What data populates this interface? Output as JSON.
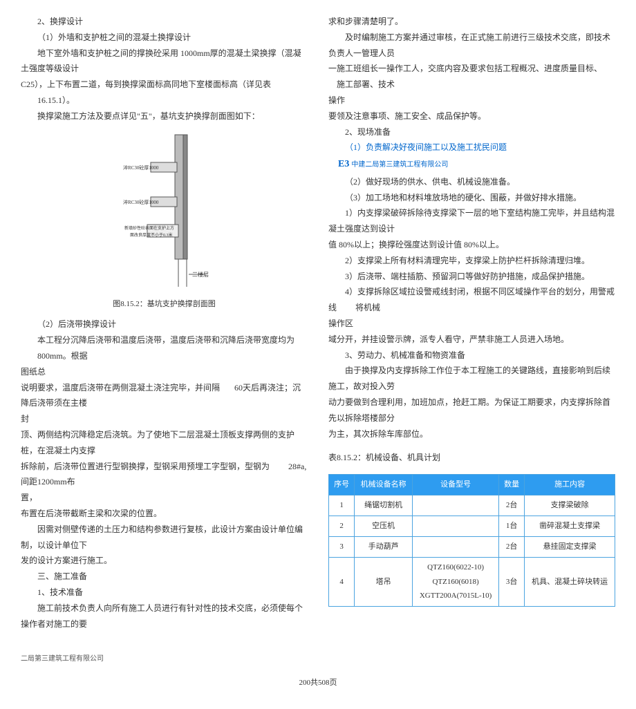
{
  "left": {
    "h1": "2、换撑设计",
    "p1": "（1）外墙和支护桩之间的混凝土换撑设计",
    "p2_a": "地下室外墙和支护桩之间的撑换砼采用 1000mm厚的混凝土梁换撑（混凝土强度等级设计",
    "p2_b": "C25），上下布置二道，每到换撑梁面标高同地下室楼面标高（详见表",
    "p2_c": "16.15.1）。",
    "p3": "换撑梁施工方法及要点详见\"五\"，基坑支护换撑剖面图如下：",
    "fig_caption": "图8.15.2：基坑支护换撑剖面图",
    "diagram_label1": "淬RC30砼厚1000",
    "diagram_label2": "淬RC30砼厚1000",
    "diagram_label3": "新填砂性砼表面在支护上方兼做",
    "diagram_label4": "面改良厚度不小于0.3米",
    "diagram_label5": "三楼层",
    "p4": "（2）后浇带换撑设计",
    "p5_a": "本工程分沉降后浇带和温度后浇带，温度后浇带和沉降后浇带宽度均为",
    "p5_b": "800mm。根据",
    "p5_c": "图纸总",
    "p6_a": "说明要求，温度后浇带在两侧混凝土浇注完毕，并间隔",
    "p6_b": "60天后再浇注；沉降后浇带须在主楼",
    "p6_c": "封",
    "p7_a": "顶、两侧结构沉降稳定后浇筑。为了使地下二层混凝土顶板支撑两侧的支护桩，在混凝土内支撑",
    "p7_b": "拆除前，后浇带位置进行型钢换撑，型钢采用预埋工字型钢，型钢为",
    "p7_c": "28#a,间距1200mm布",
    "p7_d": "置，",
    "p8": "布置在后浇带截断主梁和次梁的位置。",
    "p9": "因需对侧壁传递的土压力和结构参数进行复核，此设计方案由设计单位编制，以设计单位下",
    "p10": "发的设计方案进行施工。",
    "h2": "三、施工准备",
    "h3": "1、技术准备",
    "p11": "施工前技术负责人向所有施工人员进行有针对性的技术交底，必须使每个操作者对施工的要",
    "footer": "二局第三建筑工程有限公司"
  },
  "right": {
    "p1": "求和步骤清楚明了。",
    "p2": "及时编制施工方案并通过审核，在正式施工前进行三级技术交底，即技术负责人一管理人员",
    "p3_a": "一施工班组长一操作工人，交底内容及要求包括工程概况、进度质量目标、",
    "p3_b": "施工部署、技术",
    "p3_c": "操作",
    "p4": "要领及注意事项、施工安全、成品保护等。",
    "h1": "2、现场准备",
    "p5": "（1）负责解决好夜间施工以及施工扰民问题",
    "e3": "E3",
    "e3_sub": "中建二局第三建筑工程有限公司",
    "p6": "（2）做好现场的供水、供电、机械设施准备。",
    "p7": "（3）加工场地和材料堆放场地的硬化、围蔽，并做好排水措施。",
    "p8": "1）内支撑梁破碎拆除待支撑梁下一层的地下室结构施工完毕，并且结构混凝土强度达到设计",
    "p9": "值 80%以上；换撑砼强度达到设计值 80%以上。",
    "p10": "2）支撑梁上所有材料清理完毕，支撑梁上防护栏杆拆除清理归堆。",
    "p11": "3）后浇带、端柱插筋、预留洞口等做好防护措施，成品保护措施。",
    "p12_a": "4）支撑拆除区域拉设警戒线封闭，根据不同区域操作平台的划分，用警戒线",
    "p12_b": "将机械",
    "p12_c": "操作区",
    "p13": "域分开，并挂设警示牌，派专人看守，严禁非施工人员进入场地。",
    "h2": "3、劳动力、机械准备和物资准备",
    "p14": "由于换撑及内支撑拆除工作位于本工程施工的关键路线，直接影响到后续施工，故对投入劳",
    "p15": "动力要做到合理利用，加班加点，抢赶工期。为保证工期要求，内支撑拆除首先以拆除塔楼部分",
    "p16": "为主，其次拆除车库部位。",
    "table_caption": "表8.15.2：机械设备、机具计划",
    "table": {
      "headers": [
        "序号",
        "机械设备名称",
        "设备型号",
        "数量",
        "施工内容"
      ],
      "rows": [
        [
          "1",
          "绳锯切割机",
          "",
          "2台",
          "支撑梁破除"
        ],
        [
          "2",
          "空压机",
          "",
          "1台",
          "凿碎混凝土支撑梁"
        ],
        [
          "3",
          "手动葫芦",
          "",
          "2台",
          "悬挂固定支撑梁"
        ],
        [
          "4",
          "塔吊",
          "QTZ160(6022-10)\nQTZ160(6018)\nXGTT200A(7015L-10)",
          "3台",
          "机具、混凝土碎块转运"
        ]
      ]
    }
  },
  "page": "200共508页"
}
